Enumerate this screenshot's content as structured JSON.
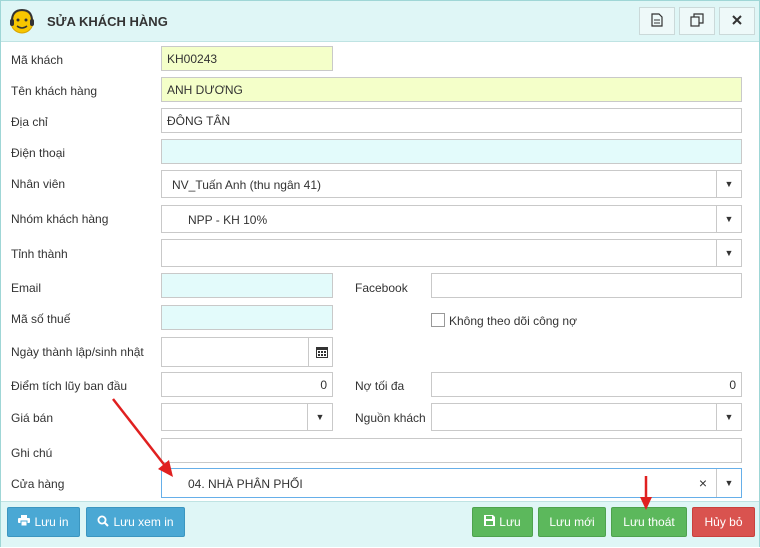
{
  "dialog": {
    "title": "SỬA KHÁCH HÀNG",
    "icons": [
      "document-icon",
      "copy-icon",
      "close-icon"
    ]
  },
  "form": {
    "ma_khach": {
      "label": "Mã khách",
      "value": "KH00243"
    },
    "ten_khach_hang": {
      "label": "Tên khách hàng",
      "value": "ANH DƯƠNG"
    },
    "dia_chi": {
      "label": "Địa chỉ",
      "value": "ĐÔNG TÂN"
    },
    "dien_thoai": {
      "label": "Điện thoại",
      "value": ""
    },
    "nhan_vien": {
      "label": "Nhân viên",
      "value": "NV_Tuấn Anh (thu ngân 41)"
    },
    "nhom_khach_hang": {
      "label": "Nhóm khách hàng",
      "value": "NPP - KH 10%"
    },
    "tinh_thanh": {
      "label": "Tỉnh thành",
      "value": ""
    },
    "email": {
      "label": "Email",
      "value": ""
    },
    "facebook": {
      "label": "Facebook",
      "value": ""
    },
    "ma_so_thue": {
      "label": "Mã số thuế",
      "value": ""
    },
    "khong_theo_doi": {
      "label": "Không theo dõi công nợ",
      "checked": false
    },
    "ngay_thanh_lap": {
      "label": "Ngày thành lập/sinh nhật",
      "value": ""
    },
    "diem_tich_luy": {
      "label": "Điểm tích lũy ban đầu",
      "value": "0"
    },
    "no_toi_da": {
      "label": "Nợ tối đa",
      "value": "0"
    },
    "gia_ban": {
      "label": "Giá bán",
      "value": ""
    },
    "nguon_khach": {
      "label": "Nguồn khách",
      "value": ""
    },
    "ghi_chu": {
      "label": "Ghi chú",
      "value": ""
    },
    "cua_hang": {
      "label": "Cửa hàng",
      "value": "04. NHÀ PHÂN PHỐI"
    }
  },
  "footer": {
    "luu_in": "Lưu in",
    "luu_xem_in": "Lưu xem in",
    "luu": "Lưu",
    "luu_moi": "Lưu mới",
    "luu_thoat": "Lưu thoát",
    "huy_bo": "Hủy bỏ"
  },
  "colors": {
    "title_bg": "#dff6f6",
    "yellow_field": "#f4ffc9",
    "cyan_field": "#e3fbfb",
    "blue_button": "#4aa8d4",
    "green_button": "#5cb85c",
    "red_button": "#d9534f",
    "annotation_arrow": "#e02020"
  }
}
